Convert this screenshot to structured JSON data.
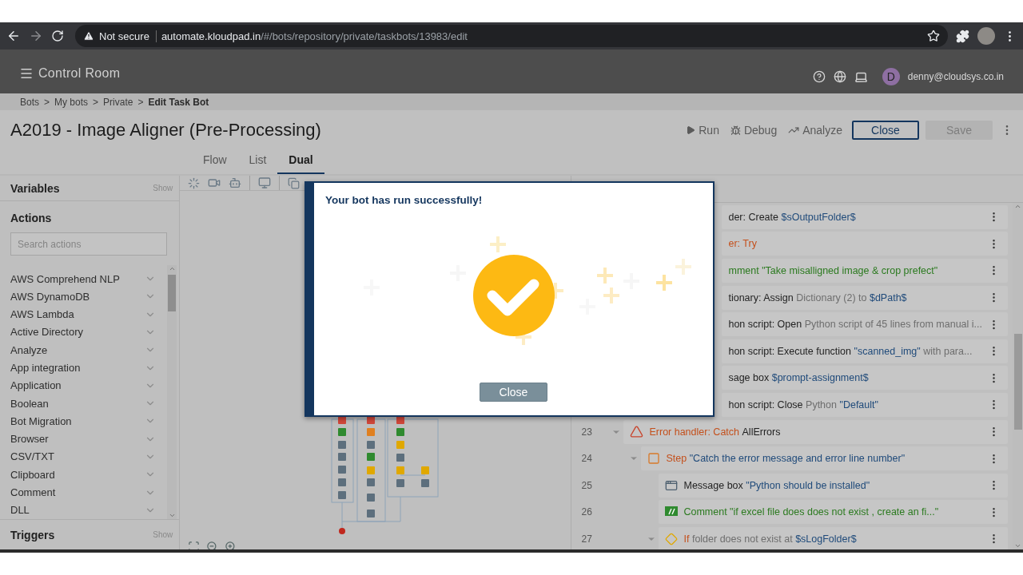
{
  "browser": {
    "security_label": "Not secure",
    "url_domain": "automate.kloudpad.in",
    "url_path": "/#/bots/repository/private/taskbots/13983/edit",
    "forward_disabled": true
  },
  "header": {
    "app_title": "Control Room",
    "avatar_letter": "D",
    "user_email": "denny@cloudsys.co.in"
  },
  "breadcrumb": [
    {
      "label": "Bots",
      "current": false,
      "separator": ">"
    },
    {
      "label": "My bots",
      "current": false,
      "separator": ">"
    },
    {
      "label": "Private",
      "current": false,
      "separator": ">"
    },
    {
      "label": "Edit Task Bot",
      "current": true
    }
  ],
  "page_title": "A2019 - Image Aligner (Pre-Processing)",
  "toolbar": [
    {
      "kind": "run",
      "label": "Run",
      "disabled": false
    },
    {
      "kind": "debug",
      "label": "Debug",
      "disabled": false
    },
    {
      "kind": "analyze",
      "label": "Analyze",
      "disabled": false
    },
    {
      "kind": "outline",
      "label": "Close",
      "disabled": false
    },
    {
      "kind": "solid",
      "label": "Save",
      "disabled": true
    }
  ],
  "view_tabs": [
    {
      "label": "Flow",
      "selected": false
    },
    {
      "label": "List",
      "selected": false
    },
    {
      "label": "Dual",
      "selected": true
    }
  ],
  "sidebar": {
    "variables": {
      "title": "Variables",
      "toggle": "Show"
    },
    "actions": {
      "title": "Actions",
      "search_placeholder": "Search actions",
      "items": [
        "AWS Comprehend NLP",
        "AWS DynamoDB",
        "AWS Lambda",
        "Active Directory",
        "Analyze",
        "App integration",
        "Application",
        "Boolean",
        "Bot Migration",
        "Browser",
        "CSV/TXT",
        "Clipboard",
        "Comment",
        "DLL"
      ]
    },
    "triggers": {
      "title": "Triggers",
      "toggle": "Show"
    }
  },
  "list_rows": [
    {
      "kind": "covered",
      "segments": [
        {
          "kind": "action",
          "text": "der: Create"
        },
        {
          "kind": "variable",
          "text": "$sOutputFolder$"
        }
      ]
    },
    {
      "kind": "covered",
      "segments": [
        {
          "kind": "error",
          "text": "er: Try"
        }
      ]
    },
    {
      "kind": "covered",
      "segments": [
        {
          "kind": "comment",
          "text": "mment \"Take misalligned image & crop prefect\""
        }
      ]
    },
    {
      "kind": "covered",
      "segments": [
        {
          "kind": "action",
          "text": "tionary: Assign"
        },
        {
          "kind": "detail",
          "text": "Dictionary (2) to"
        },
        {
          "kind": "variable",
          "text": "$dPath$"
        }
      ]
    },
    {
      "kind": "covered",
      "segments": [
        {
          "kind": "action",
          "text": "hon script: Open"
        },
        {
          "kind": "detail",
          "text": "Python script of 45 lines from manual i..."
        }
      ]
    },
    {
      "kind": "covered",
      "segments": [
        {
          "kind": "action",
          "text": "hon script: Execute function"
        },
        {
          "kind": "variable",
          "text": "\"scanned_img\""
        },
        {
          "kind": "detail",
          "text": "with para..."
        }
      ]
    },
    {
      "kind": "covered",
      "segments": [
        {
          "kind": "action",
          "text": "sage box"
        },
        {
          "kind": "variable",
          "text": "$prompt-assignment$"
        }
      ]
    },
    {
      "kind": "covered",
      "segments": [
        {
          "kind": "action",
          "text": "hon script: Close"
        },
        {
          "kind": "detail",
          "text": "Python"
        },
        {
          "kind": "variable",
          "text": "\"Default\""
        }
      ]
    },
    {
      "kind": "error_handler",
      "number": "23",
      "expanded": true,
      "segments": [
        {
          "kind": "error",
          "text": "Error handler: Catch"
        },
        {
          "kind": "action",
          "text": "AllErrors"
        }
      ],
      "children": [
        {
          "kind": "step",
          "number": "24",
          "expanded": true,
          "segments": [
            {
              "kind": "error",
              "text": "Step"
            },
            {
              "kind": "variable",
              "text": "\"Catch the error message and error line number\""
            }
          ],
          "children": [
            {
              "kind": "message_box",
              "number": "25",
              "segments": [
                {
                  "kind": "action",
                  "text": "Message box"
                },
                {
                  "kind": "variable",
                  "text": "\"Python should be installed\""
                }
              ]
            },
            {
              "kind": "comment",
              "number": "26",
              "segments": [
                {
                  "kind": "comment",
                  "text": "Comment \"if excel file does does not exist , create an fi...\""
                }
              ]
            },
            {
              "kind": "if",
              "number": "27",
              "expanded": true,
              "segments": [
                {
                  "kind": "error",
                  "text": "If"
                },
                {
                  "kind": "detail",
                  "text": "folder does not exist at"
                },
                {
                  "kind": "variable",
                  "text": "$sLogFolder$"
                }
              ]
            }
          ]
        }
      ]
    }
  ],
  "dialog": {
    "message": "Your bot has run successfully!",
    "button": "Close"
  }
}
